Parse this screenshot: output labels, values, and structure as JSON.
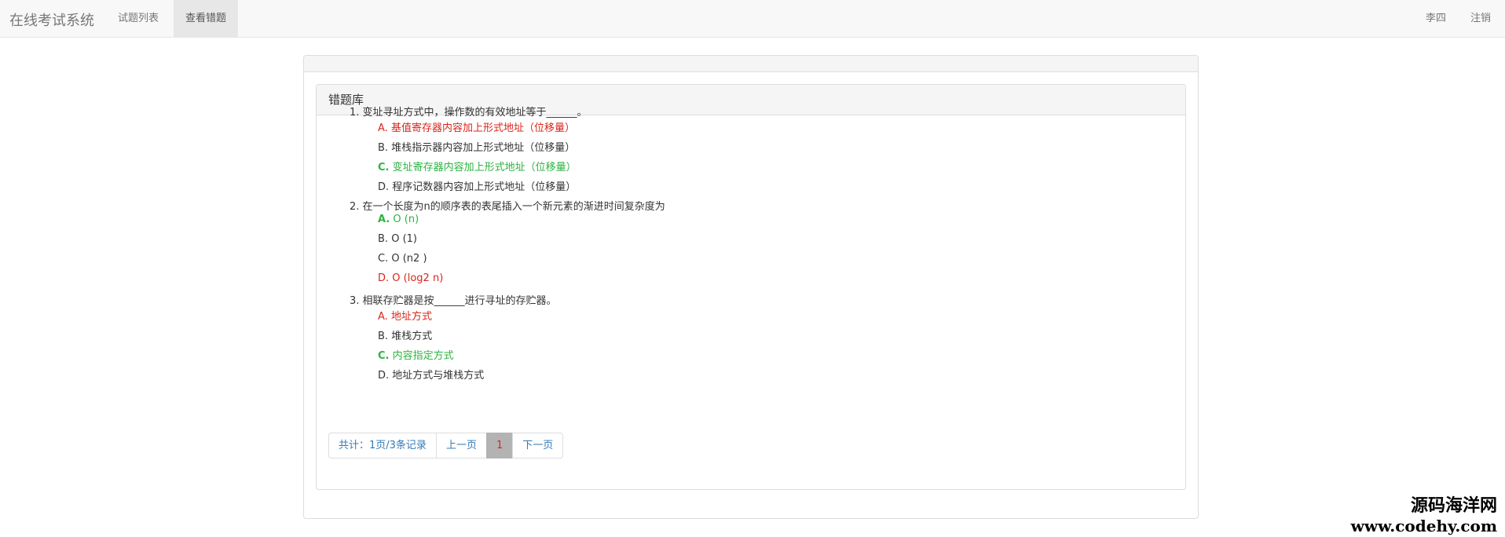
{
  "navbar": {
    "brand": "在线考试系统",
    "links": [
      "试题列表",
      "查看错题"
    ],
    "user": "李四",
    "logout": "注销"
  },
  "panel": {
    "title": "错题库"
  },
  "questions": [
    {
      "text": "1. 变址寻址方式中，操作数的有效地址等于______。",
      "options": [
        {
          "letter": "A.",
          "text": "基值寄存器内容加上形式地址（位移量）",
          "status": "wrong"
        },
        {
          "letter": "B.",
          "text": "堆栈指示器内容加上形式地址（位移量）",
          "status": "normal"
        },
        {
          "letter": "C.",
          "text": "变址寄存器内容加上形式地址（位移量）",
          "status": "correct"
        },
        {
          "letter": "D.",
          "text": "程序记数器内容加上形式地址（位移量）",
          "status": "normal"
        }
      ]
    },
    {
      "text": "2. 在一个长度为n的顺序表的表尾插入一个新元素的渐进时间复杂度为",
      "options": [
        {
          "letter": "A.",
          "text": "O (n)",
          "status": "correct"
        },
        {
          "letter": "B.",
          "text": "O (1)",
          "status": "normal"
        },
        {
          "letter": "C.",
          "text": "O (n2 )",
          "status": "normal"
        },
        {
          "letter": "D.",
          "text": "O (log2 n)",
          "status": "wrong"
        }
      ]
    },
    {
      "text": "3. 相联存贮器是按______进行寻址的存贮器。",
      "options": [
        {
          "letter": "A.",
          "text": "地址方式",
          "status": "wrong"
        },
        {
          "letter": "B.",
          "text": "堆栈方式",
          "status": "normal"
        },
        {
          "letter": "C.",
          "text": "内容指定方式",
          "status": "correct"
        },
        {
          "letter": "D.",
          "text": "地址方式与堆栈方式",
          "status": "normal"
        }
      ]
    }
  ],
  "pagination": {
    "summary": "共计：1页/3条记录",
    "prev": "上一页",
    "current": "1",
    "next": "下一页"
  },
  "watermark": {
    "line1": "源码海洋网",
    "line2": "www.codehy.com"
  },
  "colors": {
    "wrong": "#d9261c",
    "correct": "#2db341"
  }
}
